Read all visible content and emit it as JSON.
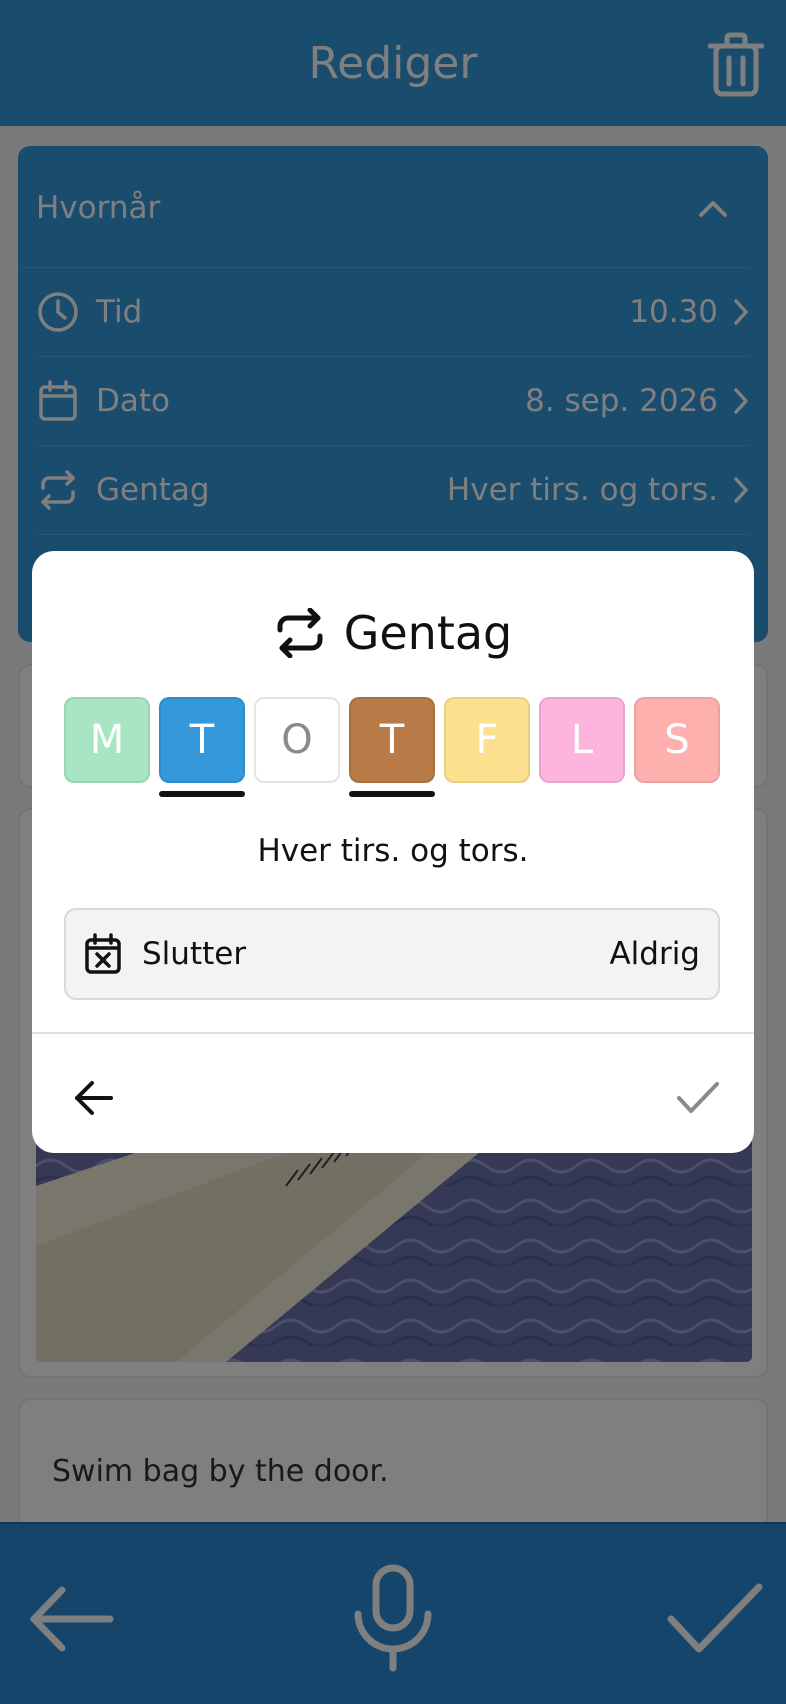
{
  "header": {
    "title": "Rediger"
  },
  "when": {
    "title": "Hvornår",
    "rows": [
      {
        "label": "Tid",
        "value": "10.30",
        "icon": "clock-icon"
      },
      {
        "label": "Dato",
        "value": "8. sep. 2026",
        "icon": "calendar-icon"
      },
      {
        "label": "Gentag",
        "value": "Hver tirs. og tors.",
        "icon": "repeat-icon"
      }
    ]
  },
  "note": {
    "text": "Swim bag by the door."
  },
  "dialog": {
    "title": "Gentag",
    "days": [
      {
        "letter": "M",
        "color": "#a8e6c3",
        "selected": false
      },
      {
        "letter": "T",
        "color": "#3498db",
        "selected": true
      },
      {
        "letter": "O",
        "color": "#ffffff",
        "selected": false
      },
      {
        "letter": "T",
        "color": "#b87a46",
        "selected": true
      },
      {
        "letter": "F",
        "color": "#fde08e",
        "selected": false
      },
      {
        "letter": "L",
        "color": "#fdb5de",
        "selected": false
      },
      {
        "letter": "S",
        "color": "#fdb0ae",
        "selected": false
      }
    ],
    "summary": "Hver tirs. og tors.",
    "ends": {
      "label": "Slutter",
      "value": "Aldrig"
    }
  },
  "colors": {
    "accent": "#3498db",
    "overlay": "rgba(0,0,0,0.5)"
  }
}
